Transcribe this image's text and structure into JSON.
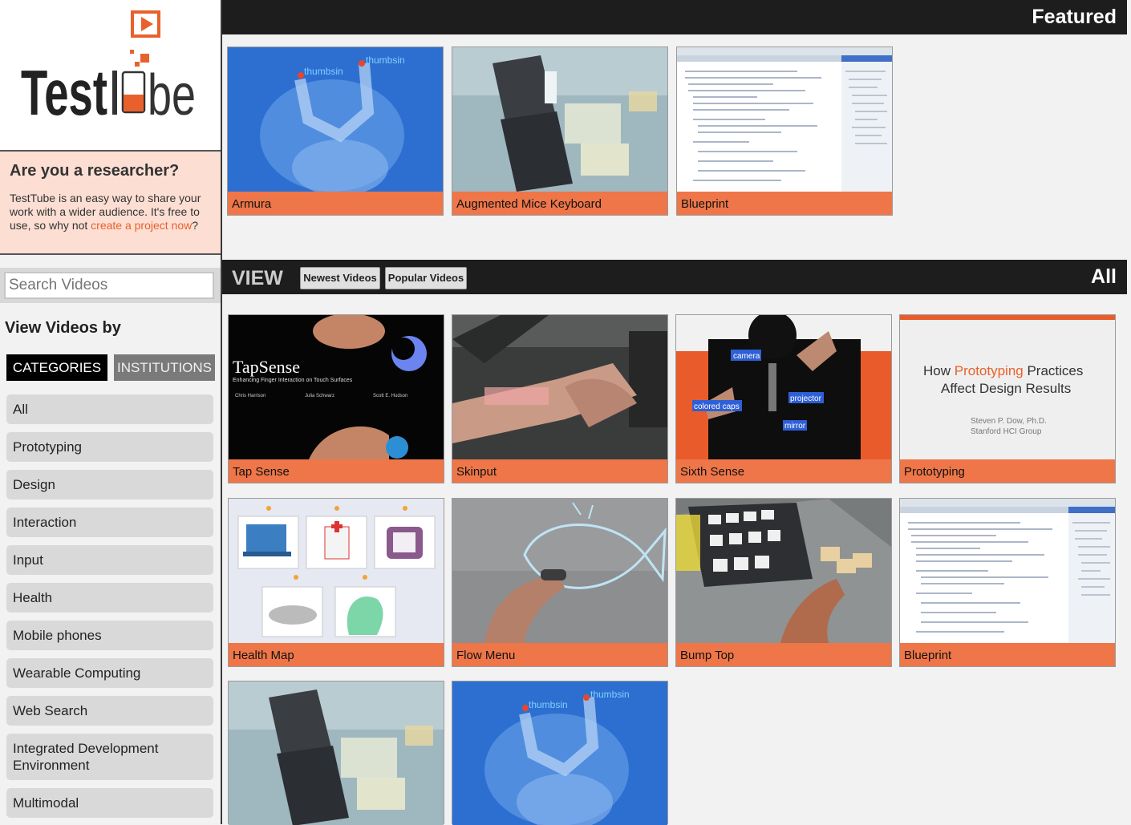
{
  "logo": {
    "text_part1": "Test",
    "text_part2": "Tube"
  },
  "research": {
    "heading": "Are you a researcher?",
    "text_before": "TestTube is an easy way to share your work with a wider audience. It's free to use, so why not ",
    "link": "create a project now",
    "text_after": "?"
  },
  "search": {
    "placeholder": "Search Videos"
  },
  "view_by": {
    "heading": "View Videos by",
    "tabs": [
      "CATEGORIES",
      "INSTITUTIONS"
    ],
    "active_tab": "CATEGORIES"
  },
  "categories": [
    "All",
    "Prototyping",
    "Design",
    "Interaction",
    "Input",
    "Health",
    "Mobile phones",
    "Wearable Computing",
    "Web Search",
    "Integrated Development Environment",
    "Multimodal"
  ],
  "featured": {
    "title": "Featured",
    "videos": [
      "Armura",
      "Augmented Mice Keyboard",
      "Blueprint"
    ]
  },
  "view": {
    "label": "VIEW",
    "buttons": [
      "Newest Videos",
      "Popular Videos"
    ],
    "filter": "All",
    "videos": [
      "Tap Sense",
      "Skinput",
      "Sixth Sense",
      "Prototyping",
      "Health Map",
      "Flow Menu",
      "Bump Top",
      "Blueprint",
      "",
      ""
    ]
  },
  "thumb_text": {
    "tapsense_title": "TapSense",
    "tapsense_sub": "Enhancing Finger Interaction on Touch Surfaces",
    "tapsense_names": [
      "Chris Harrison",
      "Julia Schwarz",
      "Scott E. Hudson"
    ],
    "proto_line1a": "How ",
    "proto_line1b": "Prototyping",
    "proto_line1c": " Practices",
    "proto_line2": "Affect Design Results",
    "proto_author": "Steven P. Dow, Ph.D.",
    "proto_org": "Stanford HCI Group",
    "sixth_labels": [
      "camera",
      "colored caps",
      "projector",
      "mirror"
    ],
    "armura_labels": [
      "thumbsin",
      "thumbsin"
    ]
  },
  "colors": {
    "accent": "#ee7648",
    "bar": "#1d1d1d",
    "research_bg": "#fcded3"
  }
}
